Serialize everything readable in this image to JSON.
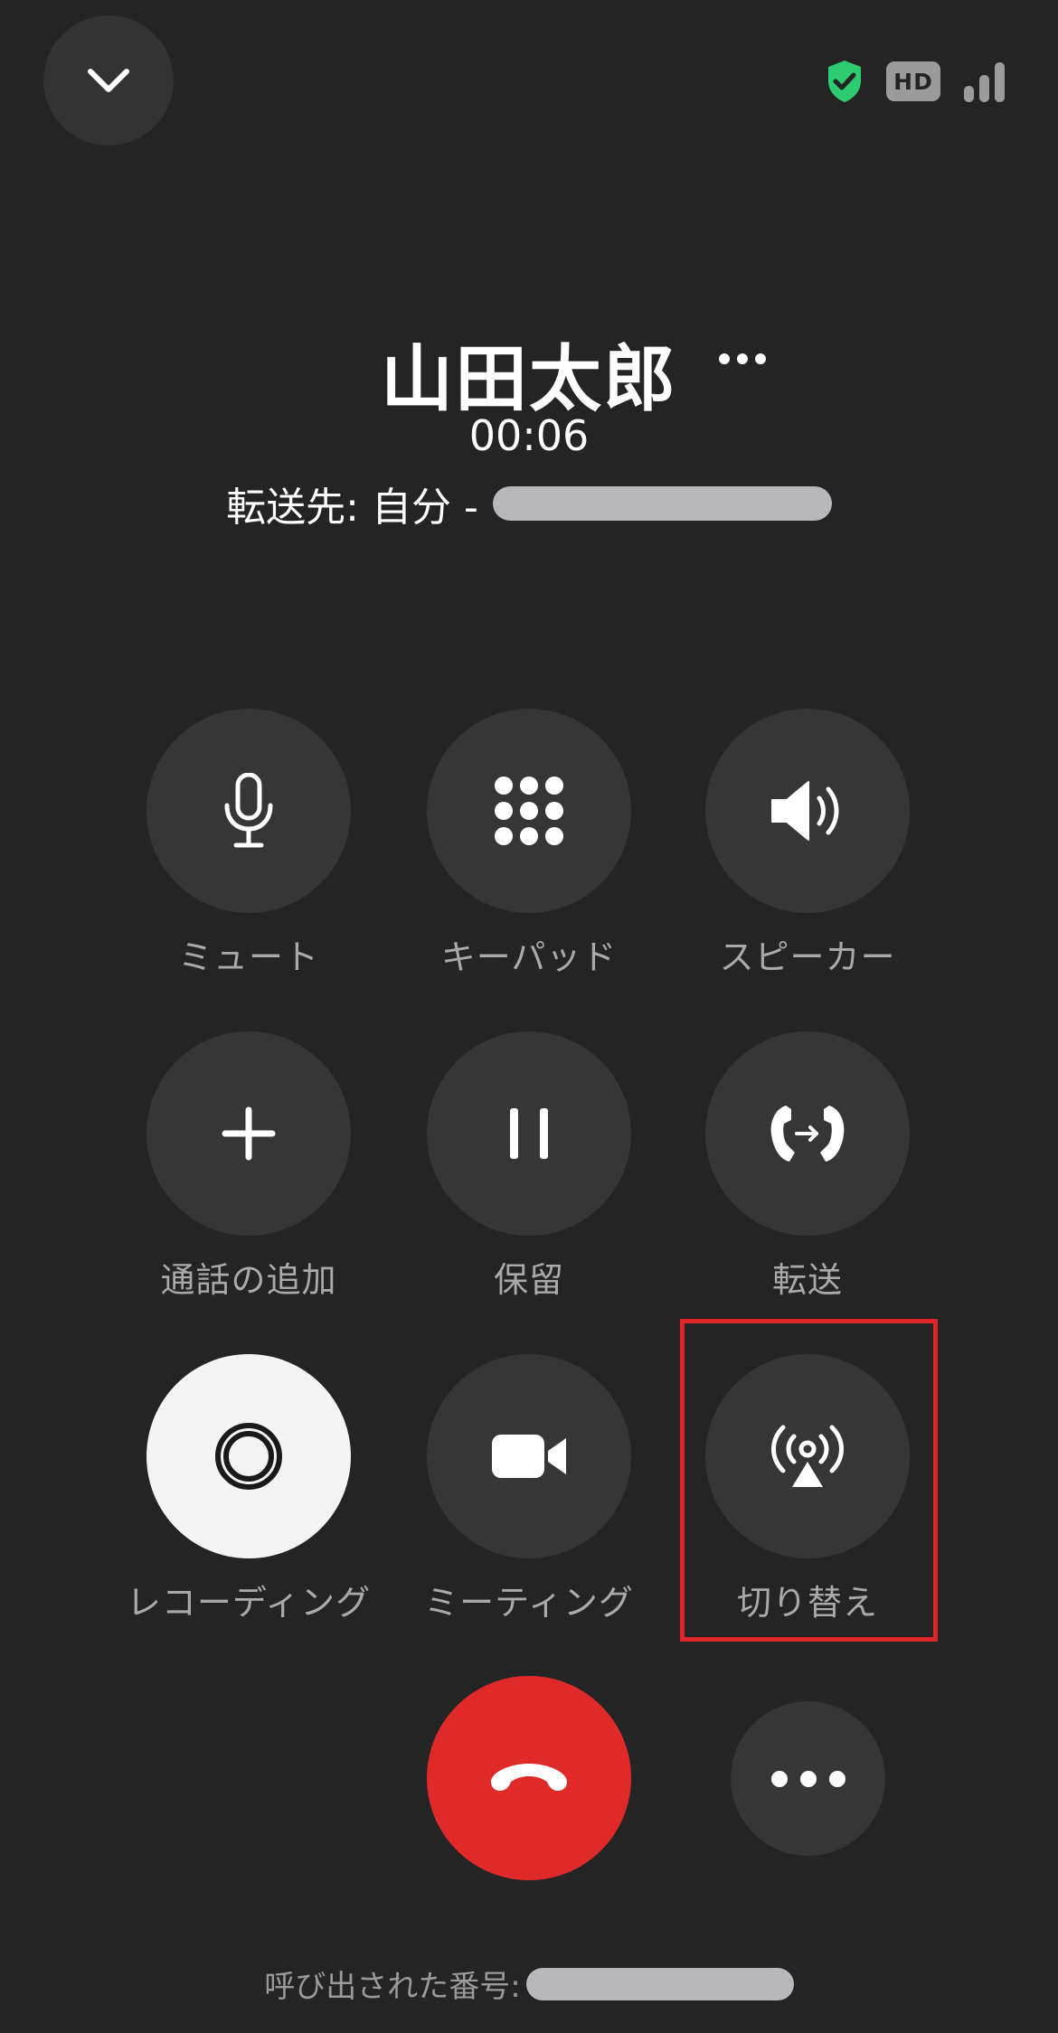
{
  "header": {
    "collapse_icon": "chevron-down-icon",
    "security_icon": "shield-check-icon",
    "security_color": "#2ecc71",
    "hd_label": "HD",
    "signal_icon": "signal-bars-icon"
  },
  "caller": {
    "name": "山田太郎",
    "timer": "00:06",
    "forward_label": "転送先: 自分 -"
  },
  "controls": [
    {
      "label": "ミュート",
      "icon": "microphone-icon"
    },
    {
      "label": "キーパッド",
      "icon": "keypad-icon"
    },
    {
      "label": "スピーカー",
      "icon": "speaker-icon"
    },
    {
      "label": "通話の追加",
      "icon": "plus-icon"
    },
    {
      "label": "保留",
      "icon": "pause-icon"
    },
    {
      "label": "転送",
      "icon": "transfer-icon"
    },
    {
      "label": "レコーディング",
      "icon": "record-icon"
    },
    {
      "label": "ミーティング",
      "icon": "video-camera-icon"
    },
    {
      "label": "切り替え",
      "icon": "broadcast-icon"
    }
  ],
  "actions": {
    "end_call_icon": "hangup-phone-icon",
    "end_call_color": "#e02a2a",
    "more_icon": "more-horizontal-icon"
  },
  "footer": {
    "called_number_label": "呼び出された番号:"
  }
}
